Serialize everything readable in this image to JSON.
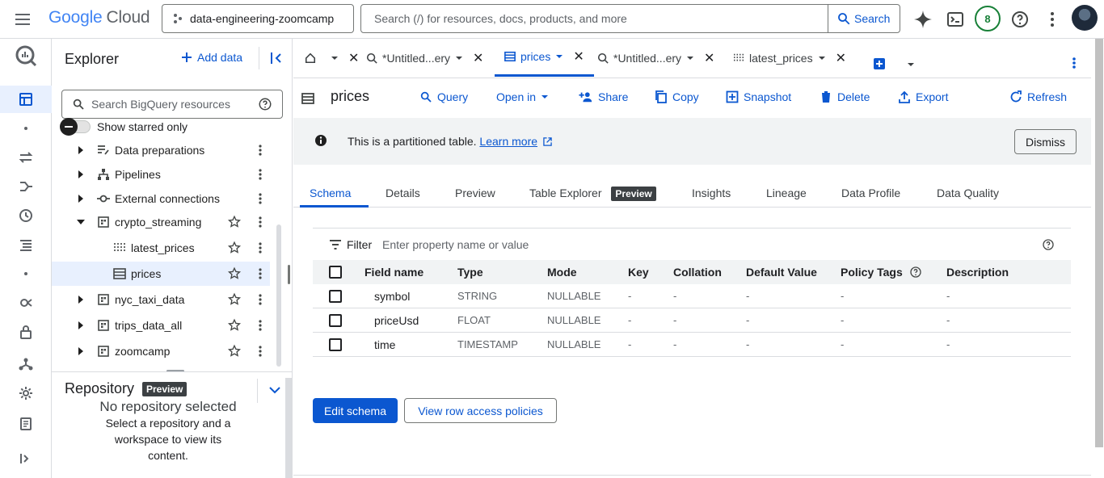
{
  "topbar": {
    "logo_google": "Google",
    "logo_cloud": "Cloud",
    "project": "data-engineering-zoomcamp",
    "search_placeholder": "Search (/) for resources, docs, products, and more",
    "search_button": "Search",
    "notification_count": "8"
  },
  "explorer": {
    "title": "Explorer",
    "add_data": "Add data",
    "search_placeholder": "Search BigQuery resources",
    "show_starred": "Show starred only",
    "items": [
      {
        "label": "Data preparations",
        "icon": "data-prep-icon"
      },
      {
        "label": "Pipelines",
        "icon": "pipeline-icon"
      },
      {
        "label": "External connections",
        "icon": "connection-icon"
      },
      {
        "label": "crypto_streaming",
        "icon": "dataset-icon"
      },
      {
        "label": "latest_prices",
        "icon": "view-icon"
      },
      {
        "label": "prices",
        "icon": "table-icon"
      },
      {
        "label": "nyc_taxi_data",
        "icon": "dataset-icon"
      },
      {
        "label": "trips_data_all",
        "icon": "dataset-icon"
      },
      {
        "label": "zoomcamp",
        "icon": "dataset-icon"
      }
    ],
    "repository": {
      "title": "Repository",
      "chip": "Preview",
      "empty_title": "No repository selected",
      "empty_line1": "Select a repository and a",
      "empty_line2": "workspace to view its",
      "empty_line3": "content."
    }
  },
  "tabs": [
    {
      "label": "",
      "icon": "home-icon"
    },
    {
      "label": "*Untitled...ery",
      "icon": "query-icon"
    },
    {
      "label": "prices",
      "icon": "table-icon"
    },
    {
      "label": "*Untitled...ery",
      "icon": "query-icon"
    },
    {
      "label": "latest_prices",
      "icon": "view-icon"
    }
  ],
  "toolbar": {
    "title": "prices",
    "query": "Query",
    "open_in": "Open in",
    "share": "Share",
    "copy": "Copy",
    "snapshot": "Snapshot",
    "delete": "Delete",
    "export": "Export",
    "refresh": "Refresh"
  },
  "banner": {
    "text": "This is a partitioned table.",
    "link": "Learn more",
    "dismiss": "Dismiss"
  },
  "subtabs": {
    "schema": "Schema",
    "details": "Details",
    "preview": "Preview",
    "table_explorer": "Table Explorer",
    "table_explorer_chip": "Preview",
    "insights": "Insights",
    "lineage": "Lineage",
    "data_profile": "Data Profile",
    "data_quality": "Data Quality"
  },
  "filter": {
    "label": "Filter",
    "placeholder": "Enter property name or value"
  },
  "schema_table": {
    "headers": {
      "field_name": "Field name",
      "type": "Type",
      "mode": "Mode",
      "key": "Key",
      "collation": "Collation",
      "default_value": "Default Value",
      "policy_tags": "Policy Tags",
      "description": "Description"
    },
    "rows": [
      {
        "name": "symbol",
        "type": "STRING",
        "mode": "NULLABLE",
        "key": "-",
        "collation": "-",
        "default": "-",
        "policy": "-",
        "description": "-"
      },
      {
        "name": "priceUsd",
        "type": "FLOAT",
        "mode": "NULLABLE",
        "key": "-",
        "collation": "-",
        "default": "-",
        "policy": "-",
        "description": "-"
      },
      {
        "name": "time",
        "type": "TIMESTAMP",
        "mode": "NULLABLE",
        "key": "-",
        "collation": "-",
        "default": "-",
        "policy": "-",
        "description": "-"
      }
    ]
  },
  "buttons": {
    "edit_schema": "Edit schema",
    "view_row_access": "View row access policies"
  },
  "colors": {
    "accent": "#0b57d0",
    "selected_bg": "#e8f0fe",
    "banner_bg": "#f1f3f4"
  }
}
